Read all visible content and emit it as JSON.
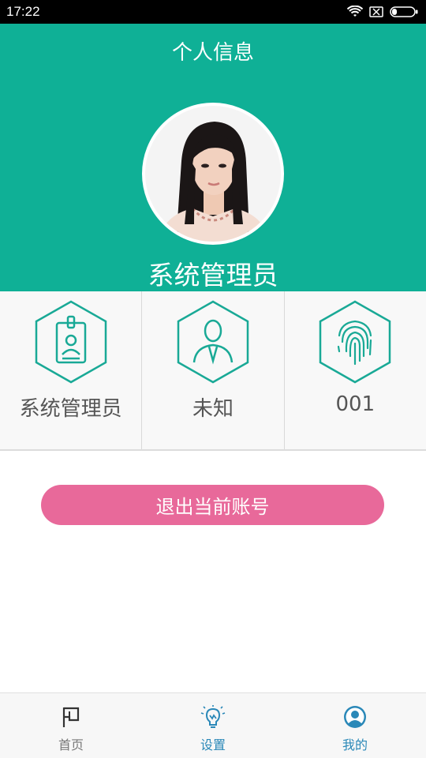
{
  "status_bar": {
    "time": "17:22"
  },
  "header": {
    "title": "个人信息",
    "user_name": "系统管理员"
  },
  "info_cards": [
    {
      "icon": "id-badge-icon",
      "label": "系统管理员"
    },
    {
      "icon": "person-icon",
      "label": "未知"
    },
    {
      "icon": "fingerprint-icon",
      "label": "001"
    }
  ],
  "logout_label": "退出当前账号",
  "bottom_nav": [
    {
      "icon": "flag-icon",
      "label": "首页"
    },
    {
      "icon": "lightbulb-icon",
      "label": "设置"
    },
    {
      "icon": "user-circle-icon",
      "label": "我的"
    }
  ],
  "colors": {
    "header": "#0fb096",
    "accent_teal": "#19a996",
    "logout": "#e8699a",
    "nav_active": "#2a88b8"
  }
}
